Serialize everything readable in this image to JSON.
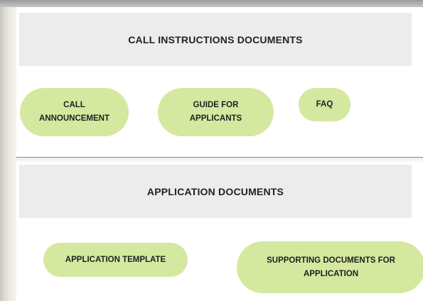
{
  "sections": [
    {
      "title": "CALL INSTRUCTIONS DOCUMENTS",
      "buttons": [
        {
          "label": "CALL\nANNOUNCEMENT"
        },
        {
          "label": "GUIDE FOR\nAPPLICANTS"
        },
        {
          "label": "FAQ"
        }
      ]
    },
    {
      "title": "APPLICATION DOCUMENTS",
      "buttons": [
        {
          "label": "APPLICATION TEMPLATE"
        },
        {
          "label": "SUPPORTING DOCUMENTS FOR\nAPPLICATION"
        }
      ]
    }
  ],
  "colors": {
    "header_bg": "#ececec",
    "pill_bg": "#d5e8a0",
    "page_bg": "#ffffff"
  }
}
